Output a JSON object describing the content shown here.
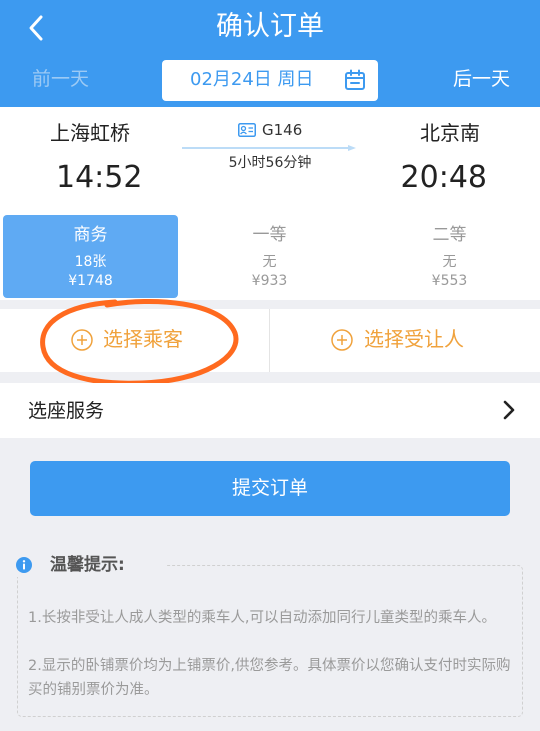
{
  "header": {
    "title": "确认订单",
    "prev_day": "前一天",
    "next_day": "后一天",
    "date": "02月24日 周日"
  },
  "train": {
    "number": "G146",
    "from_station": "上海虹桥",
    "to_station": "北京南",
    "depart_time": "14:52",
    "arrive_time": "20:48",
    "duration": "5小时56分钟"
  },
  "seats": [
    {
      "name": "商务",
      "count": "18张",
      "price": "¥1748",
      "selected": true
    },
    {
      "name": "一等",
      "count": "无",
      "price": "¥933",
      "selected": false
    },
    {
      "name": "二等",
      "count": "无",
      "price": "¥553",
      "selected": false
    }
  ],
  "passengers": {
    "choose_passenger": "选择乘客",
    "choose_beneficiary": "选择受让人"
  },
  "seat_service": {
    "label": "选座服务"
  },
  "submit": {
    "label": "提交订单"
  },
  "tips": {
    "title": "温馨提示:",
    "line1": "1.长按非受让人成人类型的乘车人,可以自动添加同行儿童类型的乘车人。",
    "line2": "2.显示的卧铺票价均为上铺票价,供您参考。具体票价以您确认支付时实际购买的铺别票价为准。"
  },
  "colors": {
    "brand_blue": "#3d9af0",
    "accent_orange": "#f0a23c",
    "annotation_orange": "#ff6a1f"
  },
  "icons": [
    "back-icon",
    "calendar-icon",
    "id-card-icon",
    "plus-circle-icon",
    "chevron-right-icon",
    "info-icon"
  ]
}
